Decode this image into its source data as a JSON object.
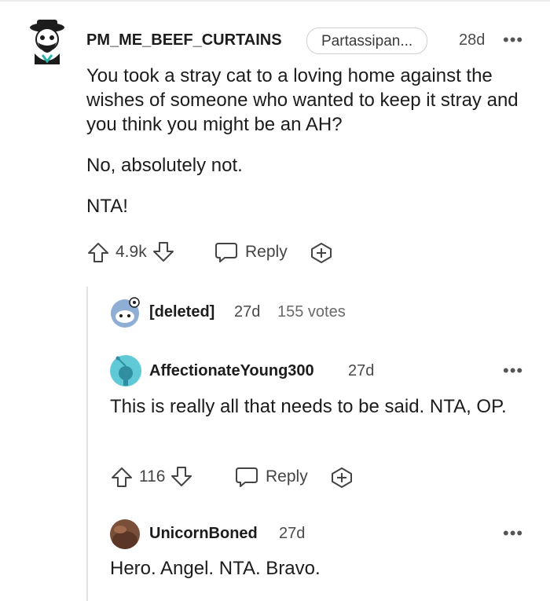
{
  "comments": [
    {
      "username": "PM_ME_BEEF_CURTAINS",
      "flair": "Partassipan...",
      "age": "28d",
      "more": "•••",
      "paragraphs": [
        "You took a stray cat to a loving home against the wishes of someone who wanted to keep it stray and you think you might be an AH?",
        "No, absolutely not.",
        "NTA!"
      ],
      "votes": "4.9k",
      "reply_label": "Reply"
    },
    {
      "username": "[deleted]",
      "age": "27d",
      "votes_text": "155 votes"
    },
    {
      "username": "AffectionateYoung300",
      "age": "27d",
      "more": "•••",
      "paragraphs": [
        "This is really all that needs to be said. NTA, OP."
      ],
      "votes": "116",
      "reply_label": "Reply"
    },
    {
      "username": "UnicornBoned",
      "age": "27d",
      "more": "•••",
      "paragraphs": [
        "Hero. Angel. NTA. Bravo."
      ]
    }
  ],
  "colors": {
    "accent": "#1c1c1c",
    "muted": "#6a6a6a",
    "thread_line": "#e3e3e3"
  },
  "icons": [
    "upvote-icon",
    "downvote-icon",
    "reply-icon",
    "award-icon",
    "more-icon"
  ]
}
